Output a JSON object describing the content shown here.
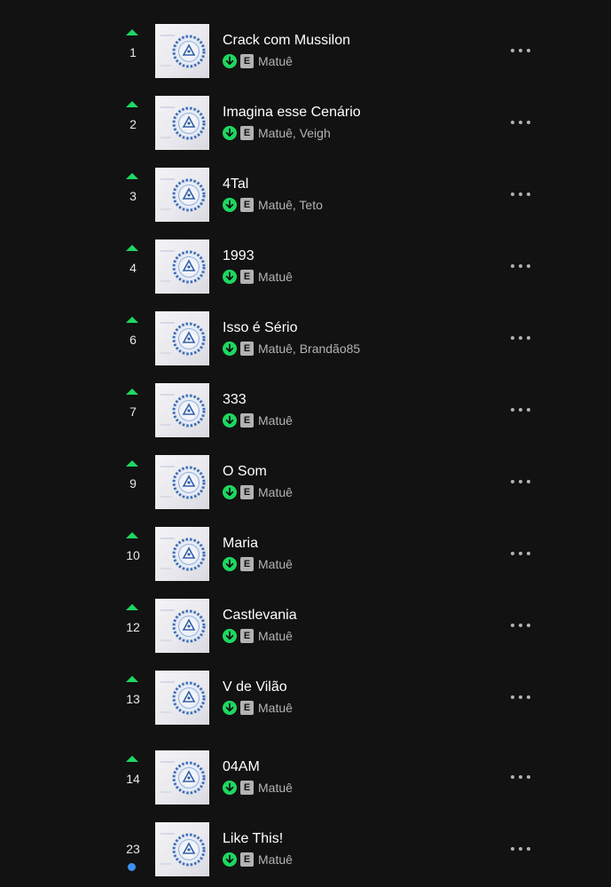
{
  "colors": {
    "background": "#121212",
    "title": "#ffffff",
    "subtitle": "#b3b3b3",
    "trend_up": "#1ed760",
    "new_dot": "#3d91f4",
    "download": "#1ed760"
  },
  "icons": {
    "trend_up": "trend-up-icon",
    "new_entry": "new-entry-dot-icon",
    "download": "download-icon",
    "explicit": "explicit-badge",
    "more": "more-options-icon",
    "cover": "album-cover"
  },
  "explicit_label": "E",
  "tracks": [
    {
      "rank": "1",
      "trend": "up",
      "title": "Crack com Mussilon",
      "artists": "Matuê"
    },
    {
      "rank": "2",
      "trend": "up",
      "title": "Imagina esse Cenário",
      "artists": "Matuê, Veigh"
    },
    {
      "rank": "3",
      "trend": "up",
      "title": "4Tal",
      "artists": "Matuê, Teto"
    },
    {
      "rank": "4",
      "trend": "up",
      "title": "1993",
      "artists": "Matuê"
    },
    {
      "rank": "6",
      "trend": "up",
      "title": "Isso é Sério",
      "artists": "Matuê, Brandão85"
    },
    {
      "rank": "7",
      "trend": "up",
      "title": "333",
      "artists": "Matuê"
    },
    {
      "rank": "9",
      "trend": "up",
      "title": "O Som",
      "artists": "Matuê"
    },
    {
      "rank": "10",
      "trend": "up",
      "title": "Maria",
      "artists": "Matuê"
    },
    {
      "rank": "12",
      "trend": "up",
      "title": "Castlevania",
      "artists": "Matuê"
    },
    {
      "rank": "13",
      "trend": "up",
      "title": "V de Vilão",
      "artists": "Matuê"
    },
    {
      "rank": "14",
      "trend": "up",
      "title": "04AM",
      "artists": "Matuê"
    },
    {
      "rank": "23",
      "trend": "new",
      "title": "Like This!",
      "artists": "Matuê"
    }
  ]
}
